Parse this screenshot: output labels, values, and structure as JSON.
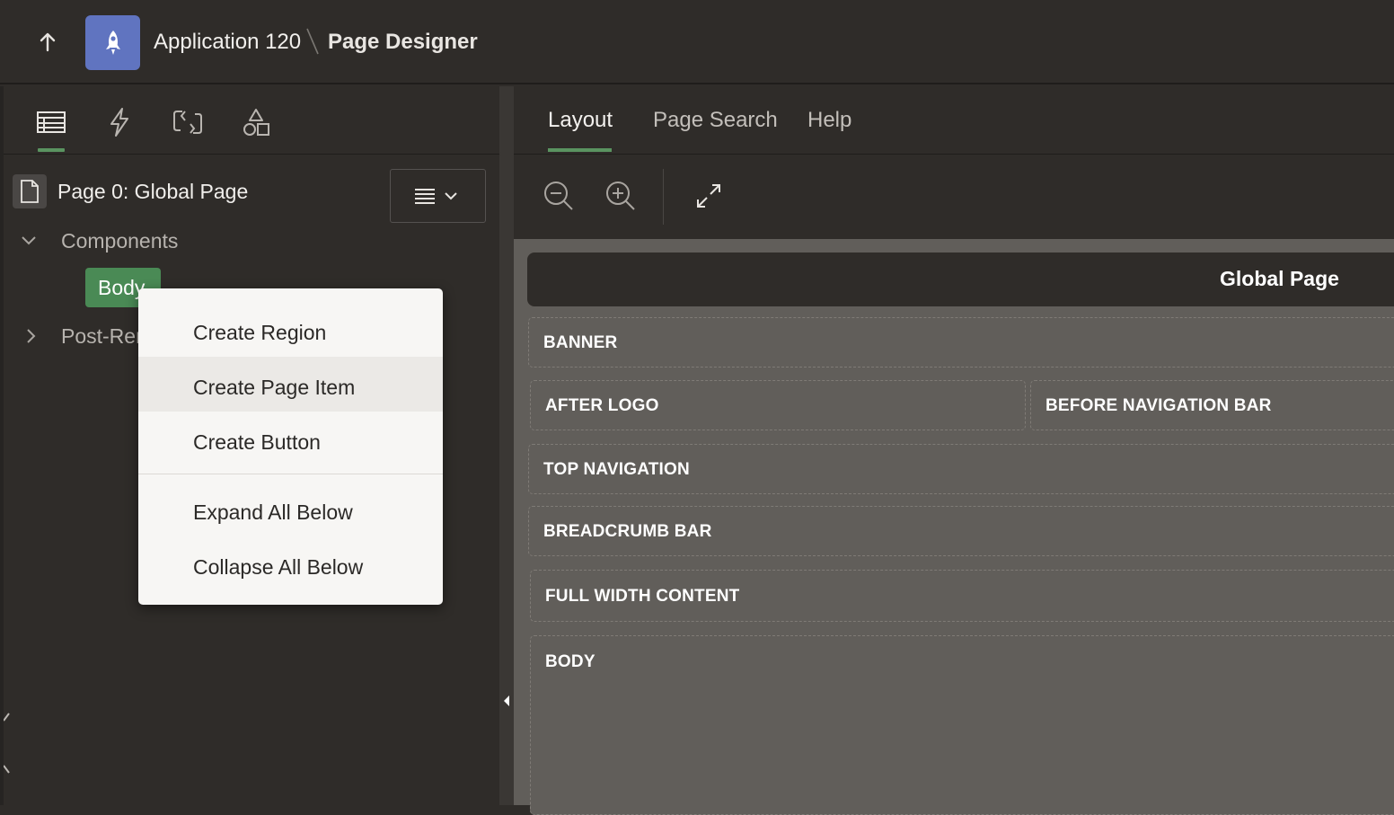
{
  "header": {
    "app_name": "Application 120",
    "page_name": "Page Designer",
    "app_badge_color": "#6074c0"
  },
  "left_panel": {
    "tabs": [
      {
        "icon": "rendering-tree-icon",
        "active": true
      },
      {
        "icon": "dynamic-actions-icon",
        "active": false
      },
      {
        "icon": "processing-icon",
        "active": false
      },
      {
        "icon": "shared-components-icon",
        "active": false
      }
    ],
    "page_title": "Page 0: Global Page",
    "tree": {
      "components_label": "Components",
      "body_label": "Body",
      "post_label": "Post-Rendering"
    }
  },
  "right_panel": {
    "tabs": [
      {
        "label": "Layout",
        "active": true
      },
      {
        "label": "Page Search",
        "active": false
      },
      {
        "label": "Help",
        "active": false
      }
    ],
    "canvas": {
      "title": "Global Page",
      "zones": {
        "banner": "BANNER",
        "after_logo": "AFTER LOGO",
        "before_nav": "BEFORE NAVIGATION BAR",
        "top_nav": "TOP NAVIGATION",
        "breadcrumb": "BREADCRUMB BAR",
        "full_width": "FULL WIDTH CONTENT",
        "body": "BODY"
      }
    }
  },
  "context_menu": {
    "items": [
      {
        "label": "Create Region",
        "highlighted": false
      },
      {
        "label": "Create Page Item",
        "highlighted": true
      },
      {
        "label": "Create Button",
        "highlighted": false
      },
      {
        "label": "Expand All Below",
        "highlighted": false
      },
      {
        "label": "Collapse All Below",
        "highlighted": false
      }
    ]
  },
  "colors": {
    "accent_green": "#5a9460",
    "body_pill": "#4a8a55"
  }
}
